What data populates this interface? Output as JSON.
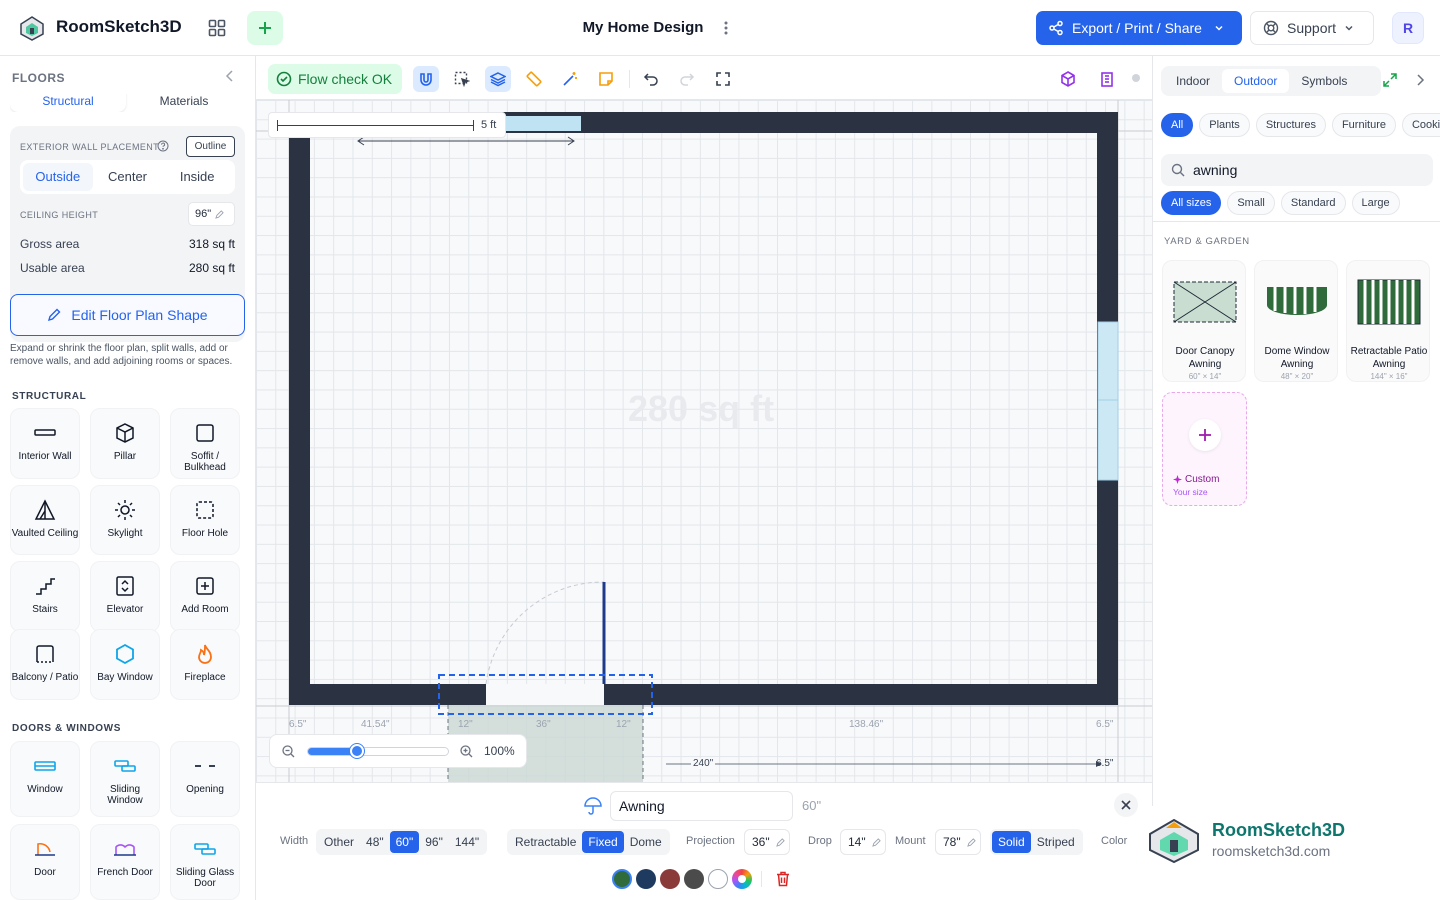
{
  "app": {
    "name": "RoomSketch3D",
    "document_title": "My Home Design",
    "avatar_initial": "R"
  },
  "header": {
    "export_label": "Export / Print / Share",
    "support_label": "Support"
  },
  "sidebar": {
    "title": "FLOORS",
    "tabs": [
      "Structural",
      "Materials"
    ],
    "exterior_wall_label": "EXTERIOR WALL PLACEMENT",
    "outline_label": "Outline",
    "placement_options": [
      "Outside",
      "Center",
      "Inside"
    ],
    "placement_selected": "Outside",
    "ceiling_label": "CEILING HEIGHT",
    "ceiling_value": "96\"",
    "gross_label": "Gross area",
    "gross_value": "318 sq ft",
    "usable_label": "Usable area",
    "usable_value": "280 sq ft",
    "edit_shape_label": "Edit Floor Plan Shape",
    "edit_help": "Expand or shrink the floor plan, split walls, add or remove walls, and add adjoining rooms or spaces.",
    "structural_heading": "STRUCTURAL",
    "structural_items": [
      "Interior Wall",
      "Pillar",
      "Soffit / Bulkhead",
      "Vaulted Ceiling",
      "Skylight",
      "Floor Hole",
      "Stairs",
      "Elevator",
      "Add Room",
      "Balcony / Patio",
      "Bay Window",
      "Fireplace"
    ],
    "doors_heading": "DOORS & WINDOWS",
    "door_items": [
      "Window",
      "Sliding Window",
      "Opening",
      "Door",
      "French Door",
      "Sliding Glass Door"
    ]
  },
  "toolbar": {
    "flow_check": "Flow check OK"
  },
  "canvas": {
    "area_label": "280 sq ft",
    "ruler_label": "5 ft",
    "dims": [
      "6.5\"",
      "41.54\"",
      "12\"",
      "36\"",
      "12\"",
      "138.46\"",
      "6.5\"",
      "240\"",
      "6.5\""
    ],
    "zoom_value": "100%",
    "zoom_level": 0.35
  },
  "props": {
    "name": "Awning",
    "size_hint": "60\"",
    "width_label": "Width",
    "width_options": [
      "Other",
      "48\"",
      "60\"",
      "96\"",
      "144\""
    ],
    "width_selected": "60\"",
    "type_options": [
      "Retractable",
      "Fixed",
      "Dome"
    ],
    "type_selected": "Fixed",
    "projection_label": "Projection",
    "projection_value": "36\"",
    "drop_label": "Drop",
    "drop_value": "14\"",
    "mount_label": "Mount",
    "mount_value": "78\"",
    "style_options": [
      "Solid",
      "Striped"
    ],
    "style_selected": "Solid",
    "color_label": "Color",
    "colors": [
      "#2f6b3b",
      "#1e3a5f",
      "#8b3a3a",
      "#4b4b4b",
      "#ffffff"
    ]
  },
  "right": {
    "tabs": [
      "Indoor",
      "Outdoor",
      "Symbols"
    ],
    "tab_selected": "Outdoor",
    "categories": [
      "All",
      "Plants",
      "Structures",
      "Furniture",
      "Cookin"
    ],
    "category_selected": "All",
    "search_value": "awning",
    "sizes": [
      "All sizes",
      "Small",
      "Standard",
      "Large"
    ],
    "size_selected": "All sizes",
    "section": "YARD & GARDEN",
    "products": [
      {
        "name": "Door Canopy Awning",
        "size": "60\" × 14\""
      },
      {
        "name": "Dome Window Awning",
        "size": "48\" × 20\""
      },
      {
        "name": "Retractable Patio Awning",
        "size": "144\" × 16\""
      }
    ],
    "custom_label": "Custom",
    "custom_sub": "Your size"
  },
  "brand": {
    "name": "RoomSketch3D",
    "url": "roomsketch3d.com"
  }
}
